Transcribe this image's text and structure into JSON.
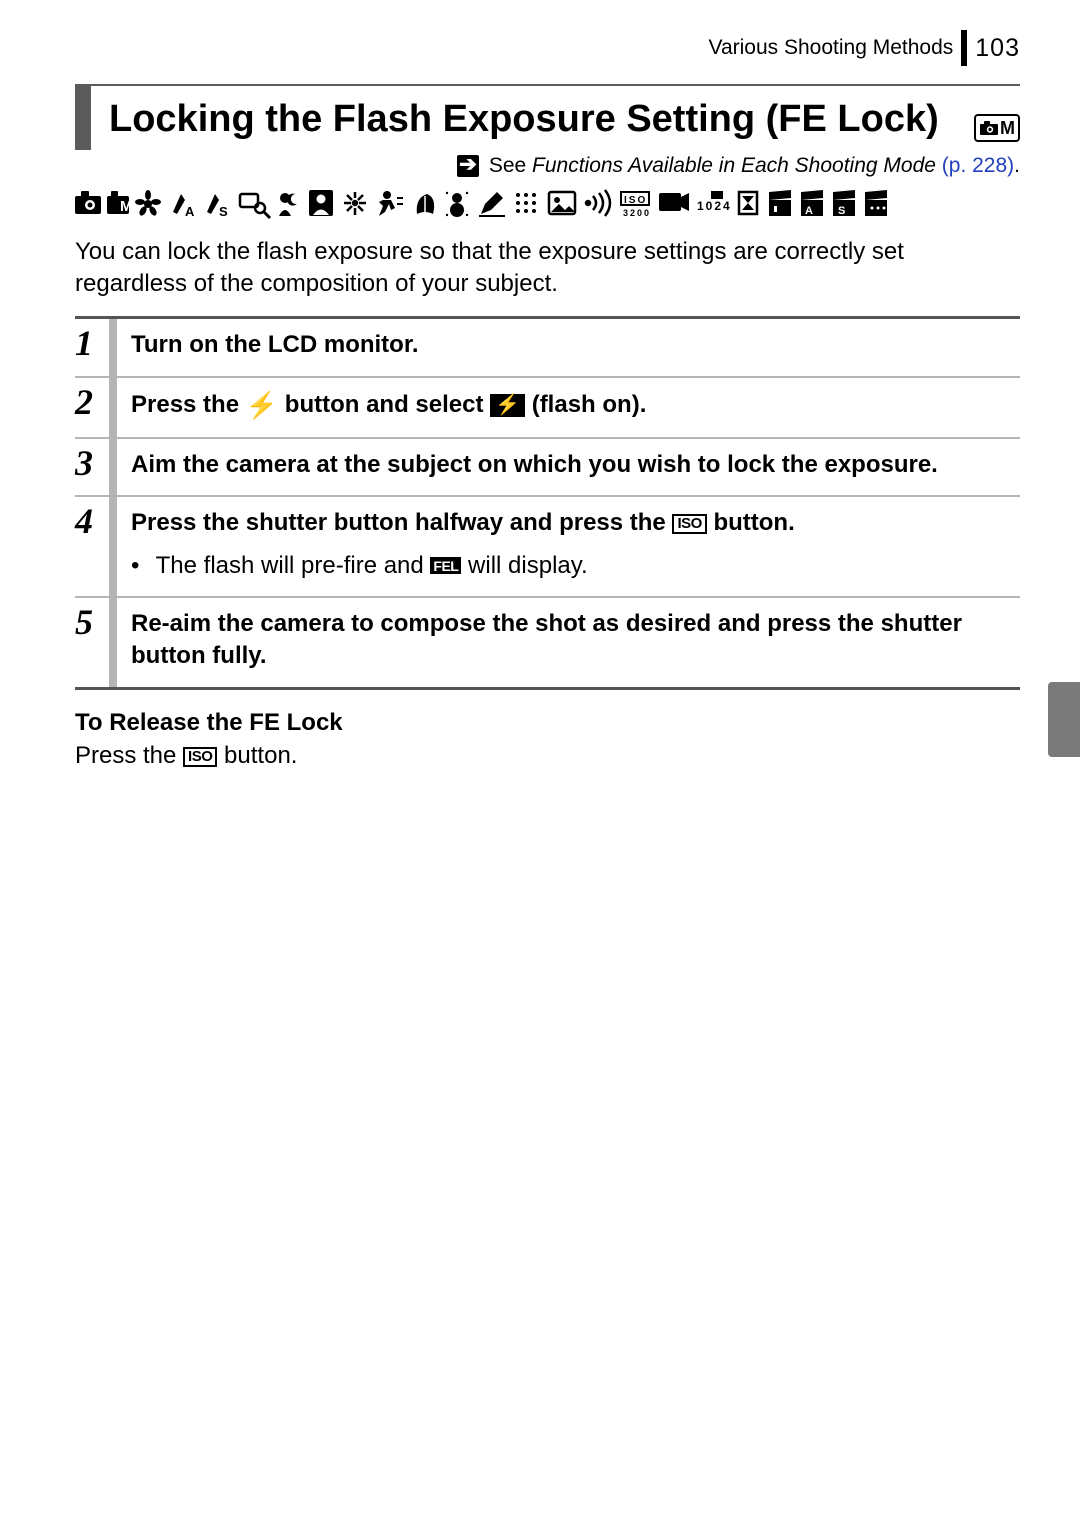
{
  "header": {
    "section": "Various Shooting Methods",
    "page_number": "103"
  },
  "title": "Locking the Flash Exposure Setting (FE Lock)",
  "mode_icon_label": "M",
  "see_ref": {
    "prefix": "See ",
    "italic": "Functions Available in Each Shooting Mode",
    "pageref": "(p. 228)",
    "dot": "."
  },
  "intro": "You can lock the flash exposure so that the exposure settings are correctly set regardless of the composition of your subject.",
  "steps": [
    {
      "num": "1",
      "head": "Turn on the LCD monitor."
    },
    {
      "num": "2",
      "head_parts": [
        "Press the ",
        "FLASH_ICON",
        " button and select ",
        "FLASHON_ICON",
        " (flash on)."
      ]
    },
    {
      "num": "3",
      "head": "Aim the camera at the subject on which you wish to lock the exposure."
    },
    {
      "num": "4",
      "head_parts": [
        "Press the shutter button halfway and press the ",
        "ISO_ICON",
        " button."
      ],
      "bullets": [
        {
          "parts": [
            "The flash will pre-fire and ",
            "FEL_ICON",
            " will display."
          ]
        }
      ]
    },
    {
      "num": "5",
      "head": "Re-aim the camera to compose the shot as desired and press the shutter button fully."
    }
  ],
  "release": {
    "head": "To Release the FE Lock",
    "parts": [
      "Press the ",
      "ISO_ICON",
      " button."
    ]
  },
  "icons": {
    "ISO_ICON": "ISO",
    "FEL_ICON": "FEL",
    "FLASHON_ICON": "⚡"
  }
}
